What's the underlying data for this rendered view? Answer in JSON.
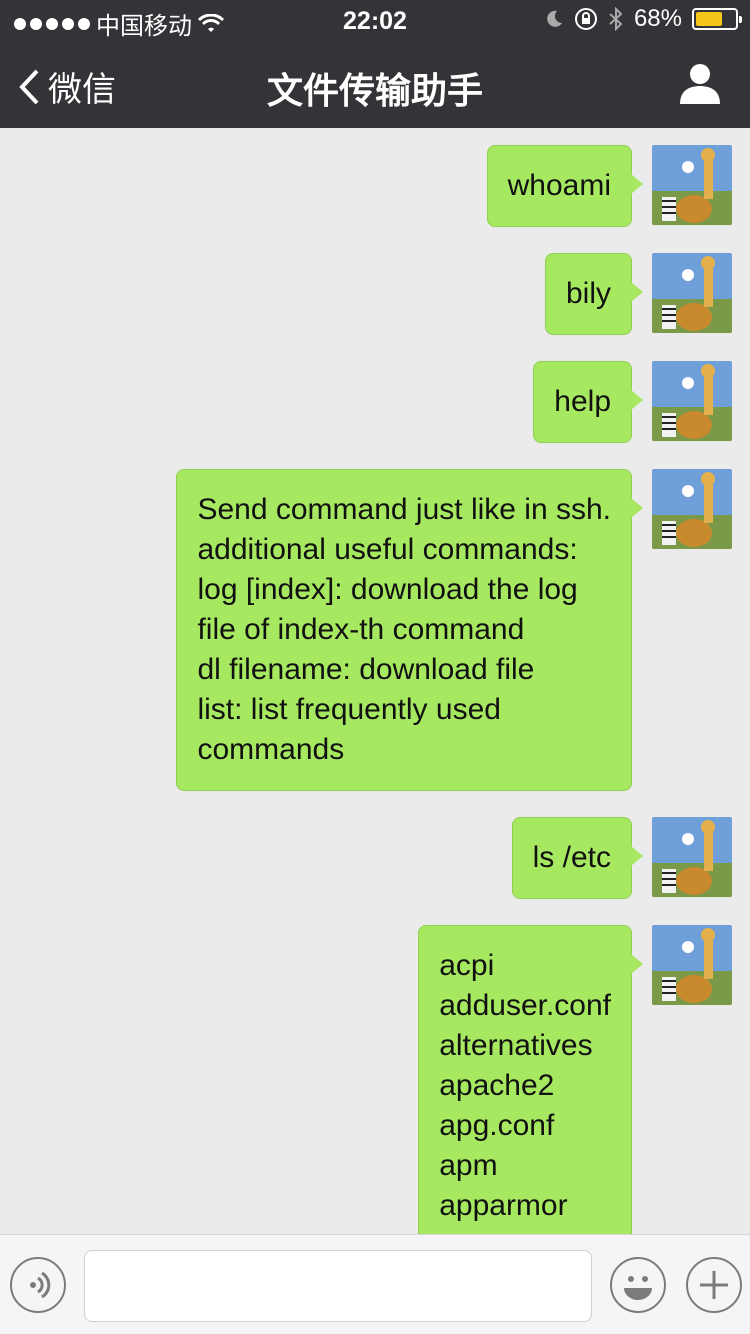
{
  "status_bar": {
    "carrier": "中国移动",
    "time": "22:02",
    "battery": "68%",
    "battery_level": 0.68
  },
  "nav": {
    "back_label": "微信",
    "title": "文件传输助手"
  },
  "messages": [
    {
      "lines": [
        "whoami"
      ]
    },
    {
      "lines": [
        "bily"
      ]
    },
    {
      "lines": [
        "help"
      ]
    },
    {
      "lines": [
        "Send command just like in ssh.",
        "additional useful commands:",
        "log [index]: download the log",
        "file of index-th command",
        "dl filename: download file",
        "list: list frequently used",
        "commands"
      ]
    },
    {
      "lines": [
        "ls /etc"
      ]
    },
    {
      "lines": [
        "acpi",
        "adduser.conf",
        "alternatives",
        "apache2",
        "apg.conf",
        "apm",
        "apparmor"
      ]
    }
  ],
  "input": {
    "placeholder": ""
  },
  "colors": {
    "nav_bg": "#333437",
    "bubble": "#a6e860",
    "chat_bg": "#ebebeb",
    "battery": "#f5c518"
  }
}
